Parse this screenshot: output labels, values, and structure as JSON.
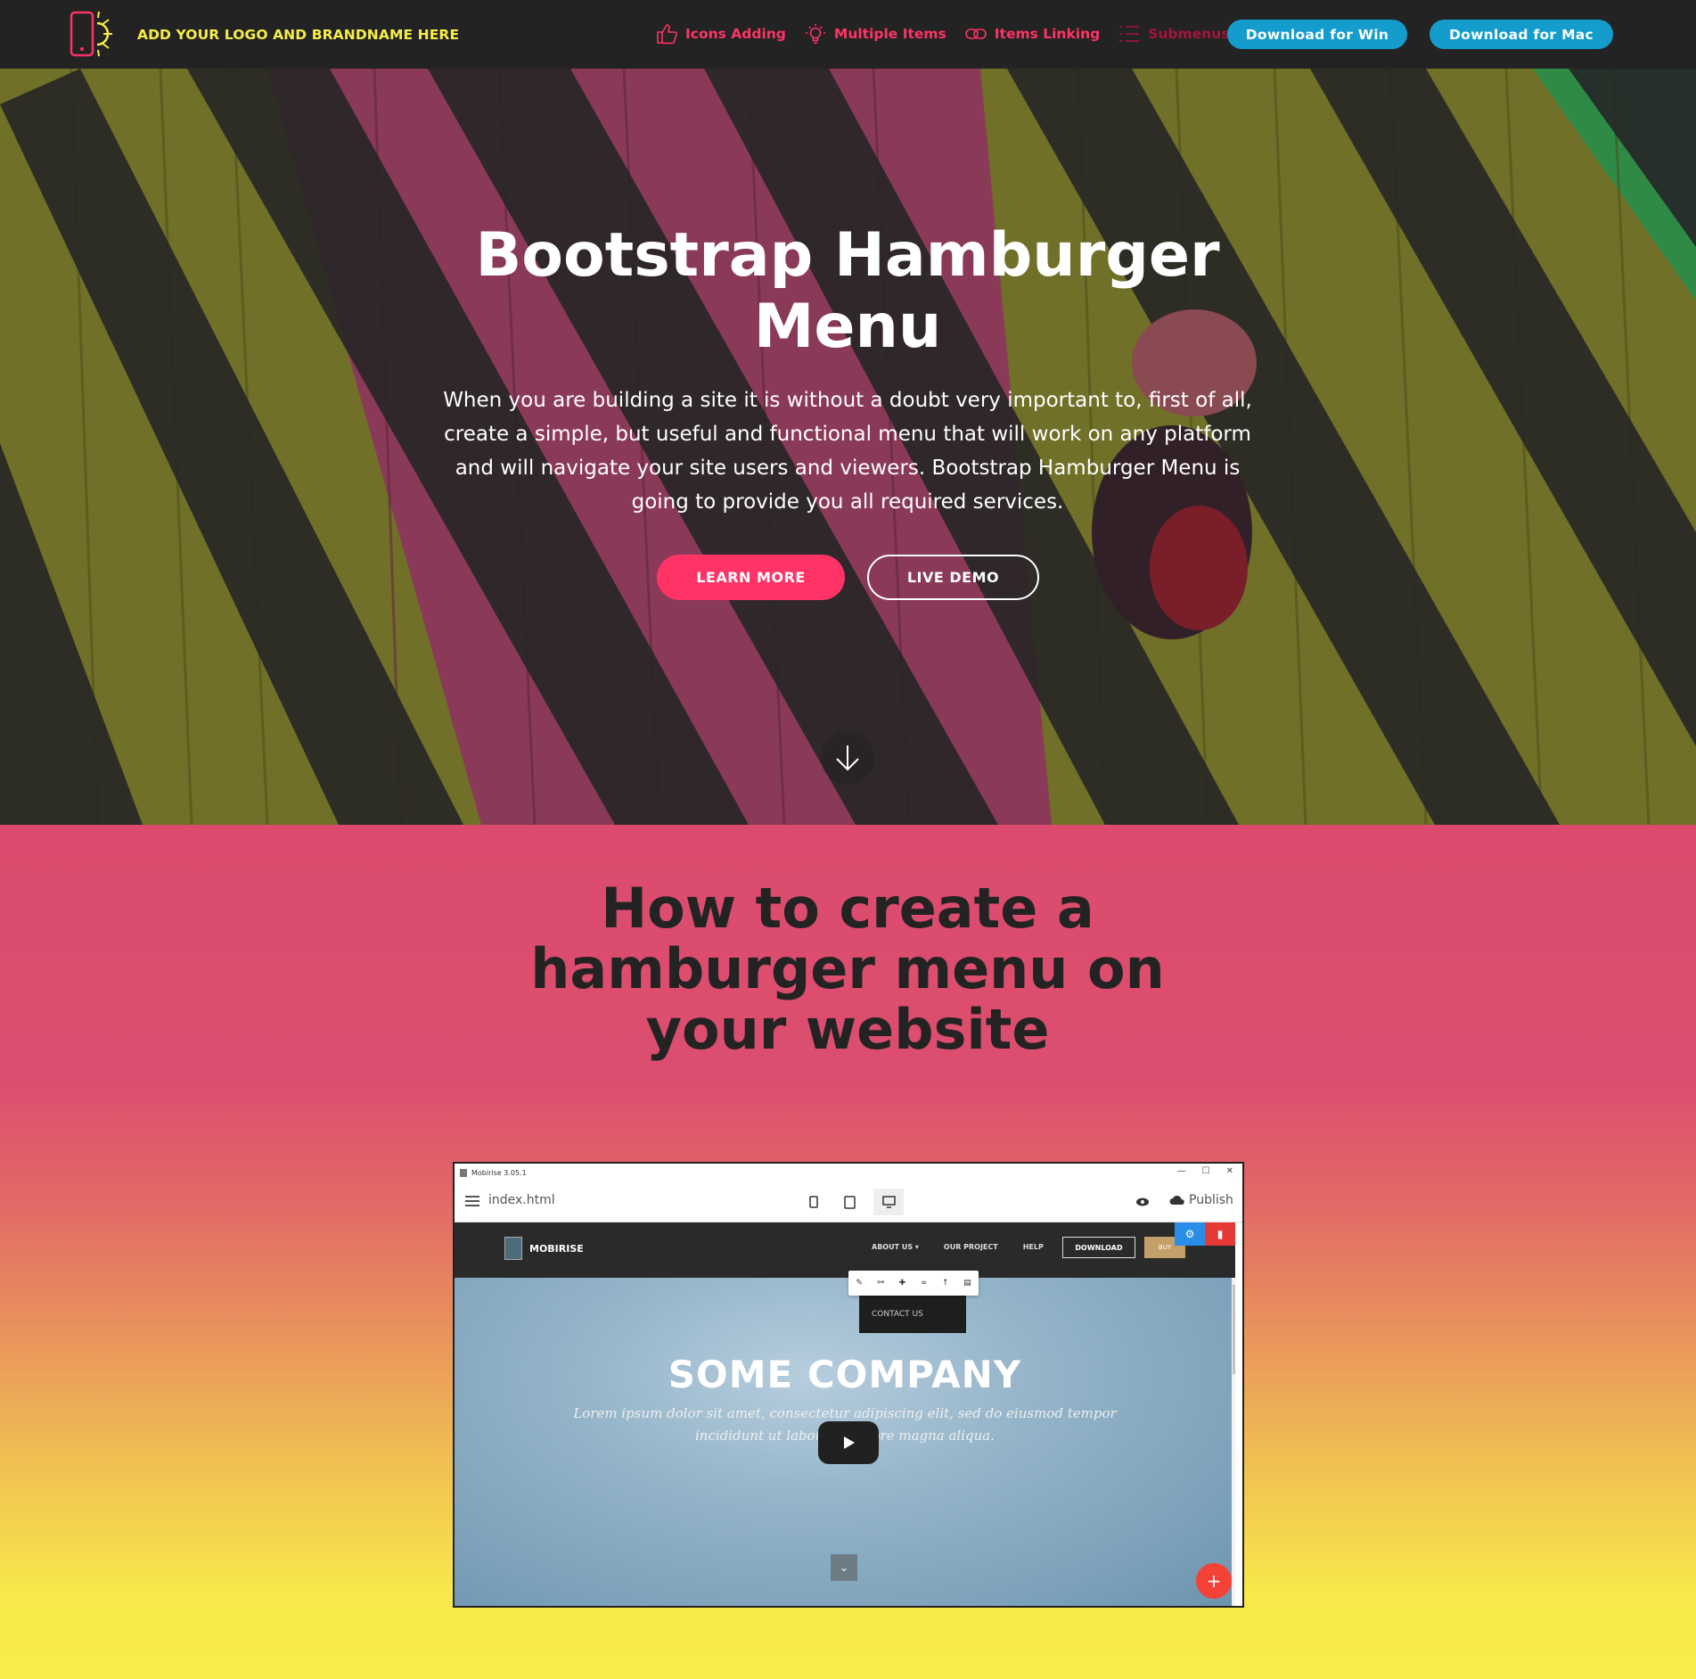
{
  "navbar": {
    "brand_text": "ADD YOUR LOGO AND BRANDNAME HERE",
    "items": [
      {
        "label": "Icons Adding",
        "icon": "thumbs-up-icon"
      },
      {
        "label": "Multiple Items",
        "icon": "lightbulb-icon"
      },
      {
        "label": "Items Linking",
        "icon": "link-icon"
      },
      {
        "label": "Submenus",
        "icon": "list-icon"
      }
    ],
    "download_win": "Download for Win",
    "download_mac": "Download for Mac"
  },
  "hero": {
    "title": "Bootstrap Hamburger Menu",
    "text": "When you are building a site it is without a doubt very important to, first of all, create a simple, but useful and functional menu that will work on any platform and will navigate your site users and viewers. Bootstrap Hamburger Menu is going to provide you all required services.",
    "learn_more": "LEARN MORE",
    "live_demo": "LIVE DEMO"
  },
  "section2": {
    "title": "How to create a hamburger menu on your website"
  },
  "video": {
    "window_title": "Mobirise 3.05.1",
    "filename": "index.html",
    "publish": "Publish",
    "site": {
      "brand": "MOBIRISE",
      "links": [
        "ABOUT US ▾",
        "OUR PROJECT",
        "HELP"
      ],
      "download": "DOWNLOAD",
      "buy": "BUY",
      "contact": "CONTACT US",
      "headline": "SOME COMPANY",
      "lorem": "Lorem ipsum dolor sit amet, consectetur adipiscing elit, sed do eiusmod tempor incididunt ut labore et dolore magna aliqua."
    }
  },
  "colors": {
    "brand_yellow": "#f7ed4a",
    "nav_pink": "#ff3366",
    "button_blue": "#149dcc",
    "navbar_bg": "#232323"
  }
}
